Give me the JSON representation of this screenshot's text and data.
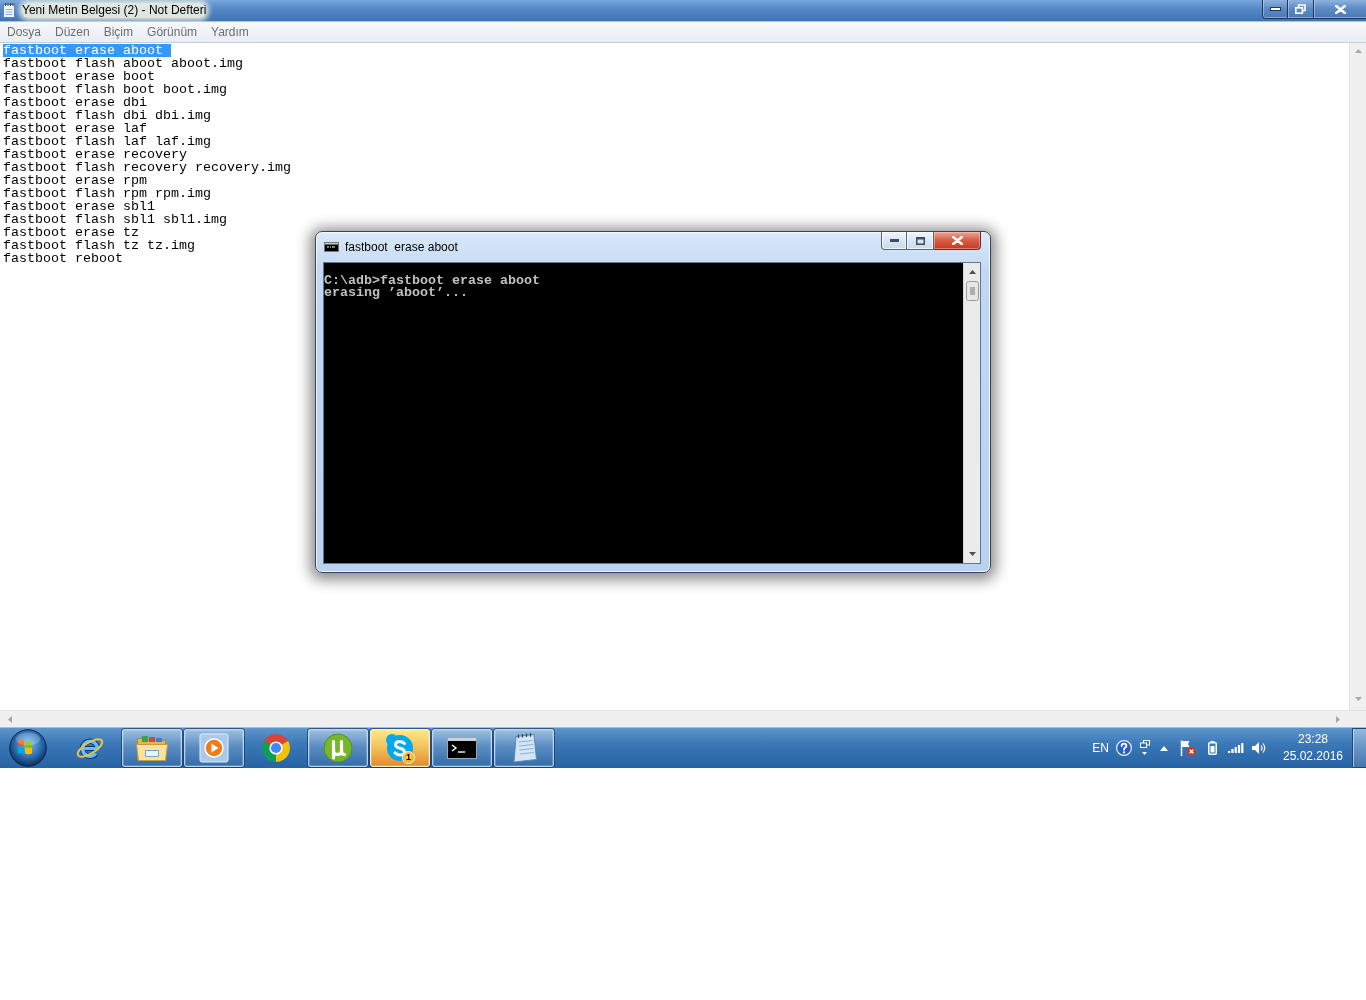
{
  "notepad": {
    "title": "Yeni Metin Belgesi (2) - Not Defteri",
    "menu": [
      "Dosya",
      "Düzen",
      "Biçim",
      "Görünüm",
      "Yardım"
    ],
    "lines": [
      {
        "text": "fastboot erase aboot",
        "selected": true
      },
      {
        "text": "fastboot flash aboot aboot.img",
        "selected": false
      },
      {
        "text": "fastboot erase boot",
        "selected": false
      },
      {
        "text": "fastboot flash boot boot.img",
        "selected": false
      },
      {
        "text": "fastboot erase dbi",
        "selected": false
      },
      {
        "text": "fastboot flash dbi dbi.img",
        "selected": false
      },
      {
        "text": "fastboot erase laf",
        "selected": false
      },
      {
        "text": "fastboot flash laf laf.img",
        "selected": false
      },
      {
        "text": "fastboot erase recovery",
        "selected": false
      },
      {
        "text": "fastboot flash recovery recovery.img",
        "selected": false
      },
      {
        "text": "fastboot erase rpm",
        "selected": false
      },
      {
        "text": "fastboot flash rpm rpm.img",
        "selected": false
      },
      {
        "text": "fastboot erase sbl1",
        "selected": false
      },
      {
        "text": "fastboot flash sbl1 sbl1.img",
        "selected": false
      },
      {
        "text": "fastboot erase tz",
        "selected": false
      },
      {
        "text": "fastboot flash tz tz.img",
        "selected": false
      },
      {
        "text": "fastboot reboot",
        "selected": false
      }
    ]
  },
  "console": {
    "title": "fastboot  erase aboot",
    "output": [
      "C:\\adb>fastboot erase aboot",
      "erasing ’aboot’..."
    ]
  },
  "taskbar": {
    "buttons": [
      {
        "kind": "ie",
        "running": false,
        "attention": false
      },
      {
        "kind": "explorer",
        "running": true,
        "attention": false
      },
      {
        "kind": "player",
        "running": true,
        "attention": false
      },
      {
        "kind": "chrome",
        "running": false,
        "attention": false
      },
      {
        "kind": "torrent",
        "running": true,
        "attention": false
      },
      {
        "kind": "messenger",
        "running": true,
        "attention": true,
        "badge": "1"
      },
      {
        "kind": "console",
        "running": true,
        "attention": false
      },
      {
        "kind": "notepad",
        "running": true,
        "attention": false
      }
    ],
    "tray": {
      "language": "EN",
      "time": "23:28",
      "date": "25.02.2016"
    }
  }
}
